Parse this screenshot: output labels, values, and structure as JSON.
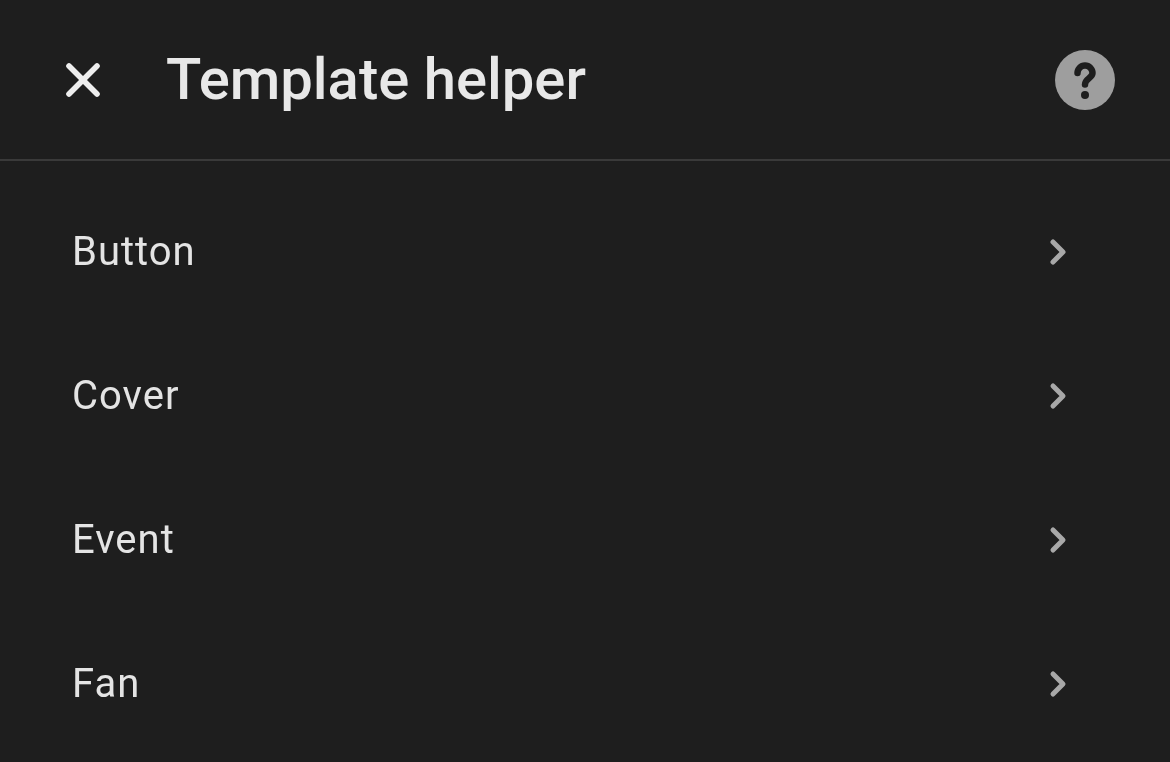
{
  "header": {
    "title": "Template helper"
  },
  "items": [
    {
      "label": "Button"
    },
    {
      "label": "Cover"
    },
    {
      "label": "Event"
    },
    {
      "label": "Fan"
    }
  ]
}
